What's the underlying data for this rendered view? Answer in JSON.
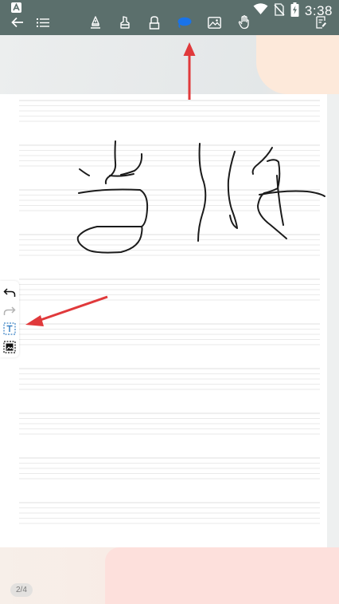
{
  "status_bar": {
    "time": "3:38",
    "icons": [
      "app-icon",
      "wifi-icon",
      "no-sim-icon",
      "battery-charging-icon"
    ]
  },
  "toolbar": {
    "icons": [
      "back-arrow-icon",
      "list-icon",
      "pen-icon",
      "highlighter-icon",
      "eraser-icon",
      "lasso-icon",
      "image-icon",
      "hand-icon",
      "notes-icon"
    ],
    "active_tool": "lasso-icon",
    "accent_color": "#1a73e8",
    "background_color": "#5b6f6c"
  },
  "side_toolbar": {
    "icons": [
      "undo-icon",
      "redo-icon",
      "text-box-icon",
      "image-insert-icon"
    ]
  },
  "canvas": {
    "handwriting": "当时"
  },
  "footer": {
    "page_indicator": "2/4"
  },
  "annotations": {
    "arrow_color": "#e0393b"
  }
}
